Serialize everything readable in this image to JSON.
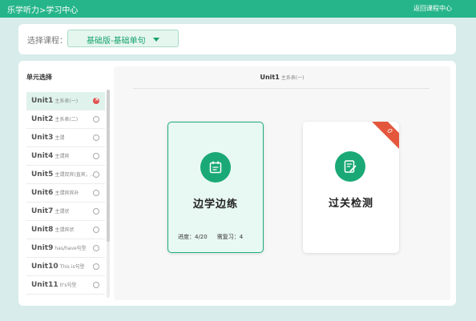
{
  "header": {
    "breadcrumb": "乐学听力>学习中心",
    "back_label": "返回课程中心"
  },
  "course": {
    "label": "选择课程：",
    "selected": "基础版-基础单句"
  },
  "sidebar": {
    "title": "单元选择",
    "units": [
      {
        "name": "Unit1",
        "desc": "主系表(一)",
        "selected": true
      },
      {
        "name": "Unit2",
        "desc": "主系表(二)",
        "selected": false
      },
      {
        "name": "Unit3",
        "desc": "主谓",
        "selected": false
      },
      {
        "name": "Unit4",
        "desc": "主谓宾",
        "selected": false
      },
      {
        "name": "Unit5",
        "desc": "主谓双宾(直宾，...",
        "selected": false
      },
      {
        "name": "Unit6",
        "desc": "主谓宾宾补",
        "selected": false
      },
      {
        "name": "Unit7",
        "desc": "主谓状",
        "selected": false
      },
      {
        "name": "Unit8",
        "desc": "主谓宾状",
        "selected": false
      },
      {
        "name": "Unit9",
        "desc": "has/have句型",
        "selected": false
      },
      {
        "name": "Unit10",
        "desc": "This is句型",
        "selected": false
      },
      {
        "name": "Unit11",
        "desc": "It's句型",
        "selected": false
      }
    ]
  },
  "main": {
    "unit_name": "Unit1",
    "unit_desc": "主系表(一)",
    "practice": {
      "icon": "calendar-icon",
      "title": "边学边练",
      "progress": "进度：4/20",
      "review": "需复习：4"
    },
    "test": {
      "icon": "document-edit-icon",
      "title": "过关检测",
      "ribbon": "0"
    }
  },
  "colors": {
    "brand": "#26b58a",
    "accent": "#1aa976",
    "ribbon": "#e4573d"
  }
}
